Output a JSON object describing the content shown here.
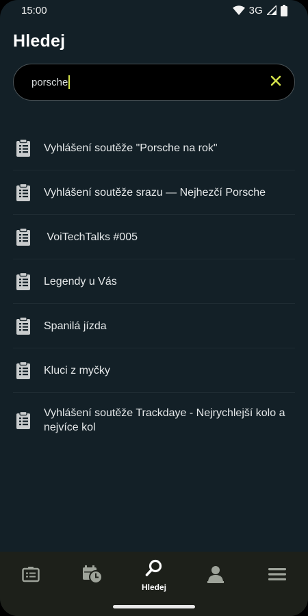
{
  "status_bar": {
    "time": "15:00",
    "network": "3G",
    "icons": [
      "wifi-icon",
      "signal-icon",
      "battery-icon"
    ]
  },
  "header": {
    "title": "Hledej"
  },
  "search": {
    "value": "porsche",
    "clear_icon": "close-icon"
  },
  "results": [
    {
      "label": "Vyhlášení soutěže \"Porsche na rok\"",
      "icon": "clipboard-list-icon"
    },
    {
      "label": "Vyhlášení soutěže srazu — Nejhezčí Porsche",
      "icon": "clipboard-list-icon"
    },
    {
      "label": " VoiTechTalks #005",
      "icon": "clipboard-list-icon"
    },
    {
      "label": "Legendy u Vás",
      "icon": "clipboard-list-icon"
    },
    {
      "label": "Spanilá jízda",
      "icon": "clipboard-list-icon"
    },
    {
      "label": "Kluci z myčky",
      "icon": "clipboard-list-icon"
    },
    {
      "label": "Vyhlášení soutěže Trackdaye - Nejrychlejší kolo a nejvíce kol",
      "icon": "clipboard-list-icon"
    }
  ],
  "bottom_nav": {
    "items": [
      {
        "icon": "list-card-icon",
        "label": ""
      },
      {
        "icon": "calendar-clock-icon",
        "label": ""
      },
      {
        "icon": "search-icon",
        "label": "Hledej",
        "active": true
      },
      {
        "icon": "user-icon",
        "label": ""
      },
      {
        "icon": "menu-icon",
        "label": ""
      }
    ]
  },
  "colors": {
    "background": "#132027",
    "accent": "#d4e14a",
    "nav_background": "#1d201a",
    "inactive_icon": "#9ea39a"
  }
}
